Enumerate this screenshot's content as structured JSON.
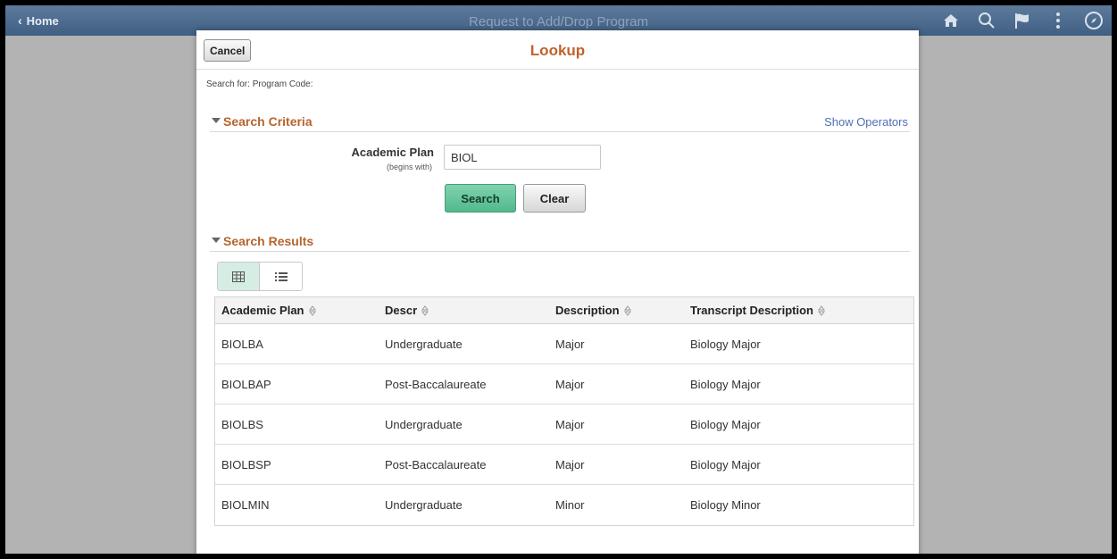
{
  "topbar": {
    "home_label": "Home",
    "page_title": "Request to Add/Drop Program"
  },
  "modal": {
    "cancel_label": "Cancel",
    "title": "Lookup",
    "search_for": "Search for:  Program Code:"
  },
  "criteria": {
    "section_label": "Search Criteria",
    "show_operators": "Show Operators",
    "field_label": "Academic Plan",
    "field_sub": "(begins with)",
    "field_value": "BIOL",
    "search_label": "Search",
    "clear_label": "Clear"
  },
  "results": {
    "section_label": "Search Results",
    "headers": [
      "Academic Plan",
      "Descr",
      "Description",
      "Transcript Description"
    ],
    "rows": [
      [
        "BIOLBA",
        "Undergraduate",
        "Major",
        "Biology Major"
      ],
      [
        "BIOLBAP",
        "Post-Baccalaureate",
        "Major",
        "Biology Major"
      ],
      [
        "BIOLBS",
        "Undergraduate",
        "Major",
        "Biology Major"
      ],
      [
        "BIOLBSP",
        "Post-Baccalaureate",
        "Major",
        "Biology Major"
      ],
      [
        "BIOLMIN",
        "Undergraduate",
        "Minor",
        "Biology Minor"
      ]
    ]
  },
  "colors": {
    "topbar": "#4a6a8e",
    "title_orange": "#c0612b",
    "section_orange": "#b5652c",
    "link_blue": "#4f6fb4",
    "search_green": "#5fc096"
  }
}
